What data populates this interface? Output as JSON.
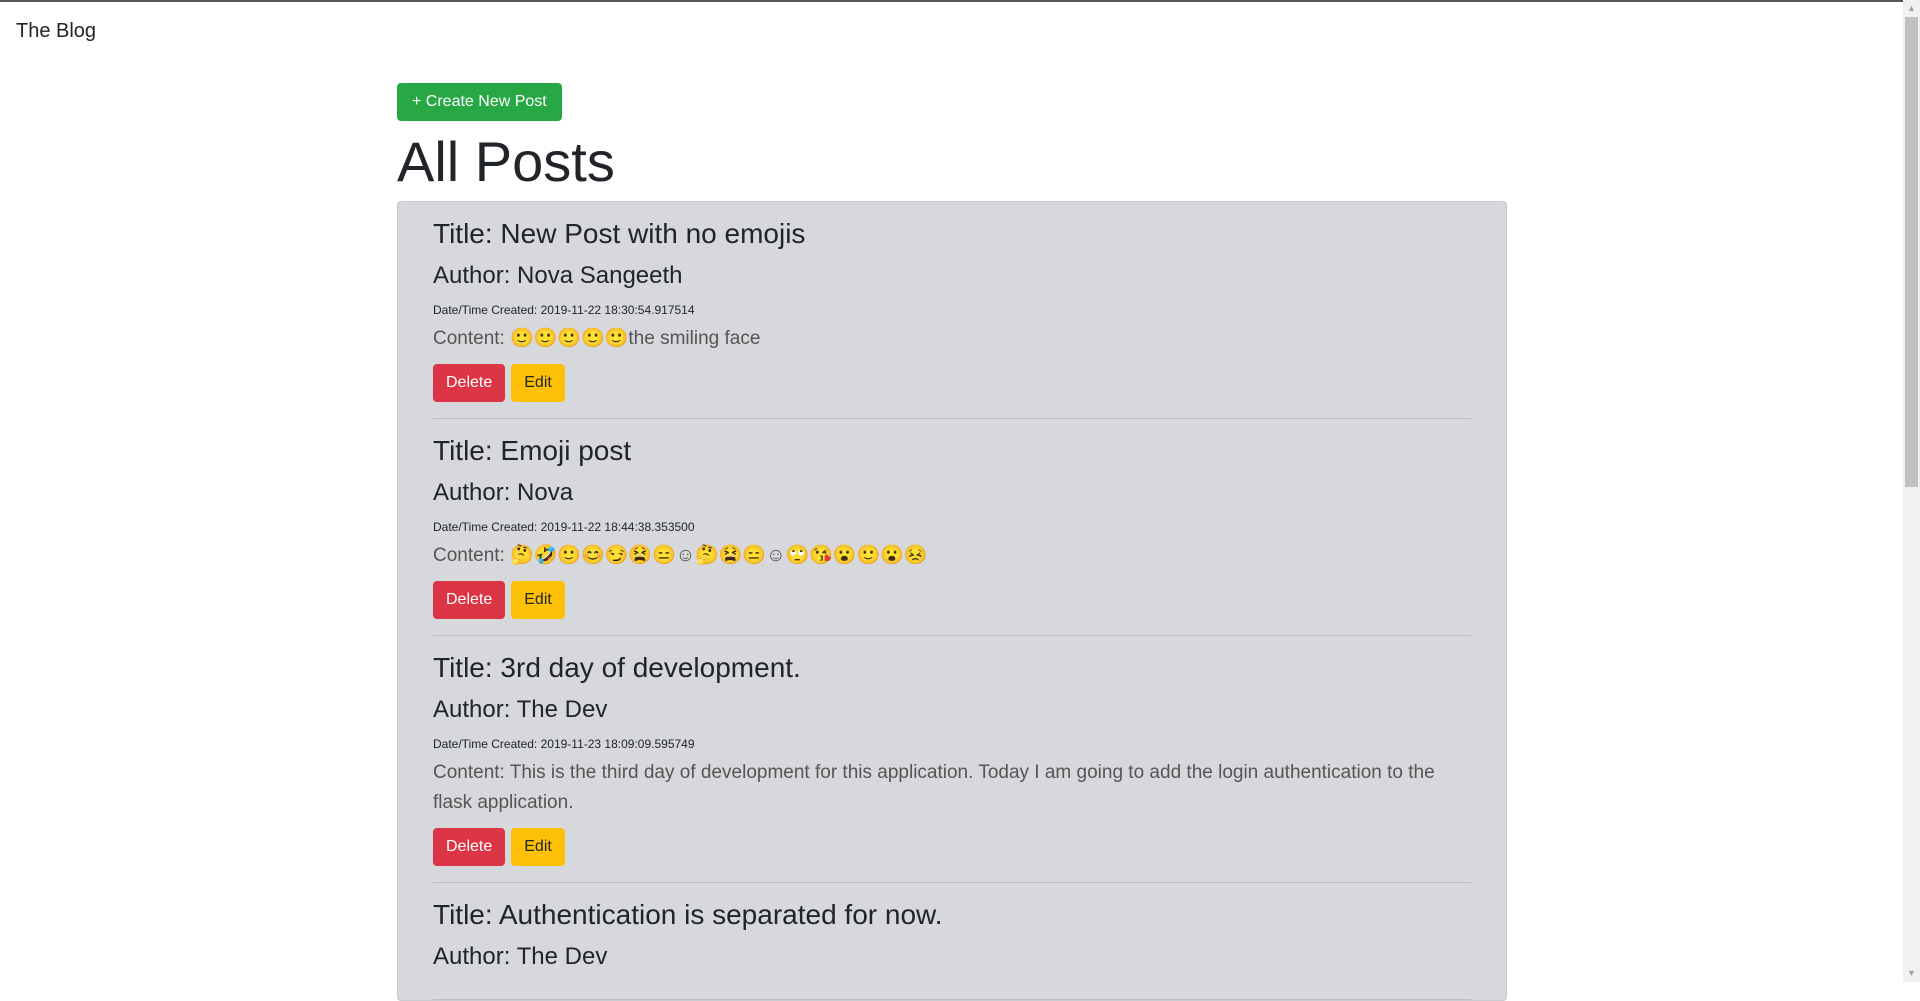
{
  "navbar": {
    "brand": "The Blog"
  },
  "main": {
    "create_button": "+ Create New Post",
    "heading": "All Posts"
  },
  "posts": [
    {
      "title": "Title: New Post with no emojis",
      "author": "Author: Nova Sangeeth",
      "date": "Date/Time Created: 2019-11-22 18:30:54.917514",
      "content": "Content: 🙂🙂🙂🙂🙂the smiling face"
    },
    {
      "title": "Title: Emoji post",
      "author": "Author: Nova",
      "date": "Date/Time Created: 2019-11-22 18:44:38.353500",
      "content": "Content: 🤔🤣🙂😊😏😫😑☺🤔😫😑☺🙄😘😮🙂😮😣"
    },
    {
      "title": "Title: 3rd day of development.",
      "author": "Author: The Dev",
      "date": "Date/Time Created: 2019-11-23 18:09:09.595749",
      "content": "Content: This is the third day of development for this application. Today I am going to add the login authentication to the flask application."
    },
    {
      "title": "Title: Authentication is separated for now.",
      "author": "Author: The Dev",
      "date": "",
      "content": ""
    }
  ],
  "actions": {
    "delete_label": "Delete",
    "edit_label": "Edit"
  },
  "colors": {
    "create": "#28a745",
    "delete": "#dc3545",
    "edit": "#ffc107",
    "card_bg": "#d6d8db"
  }
}
